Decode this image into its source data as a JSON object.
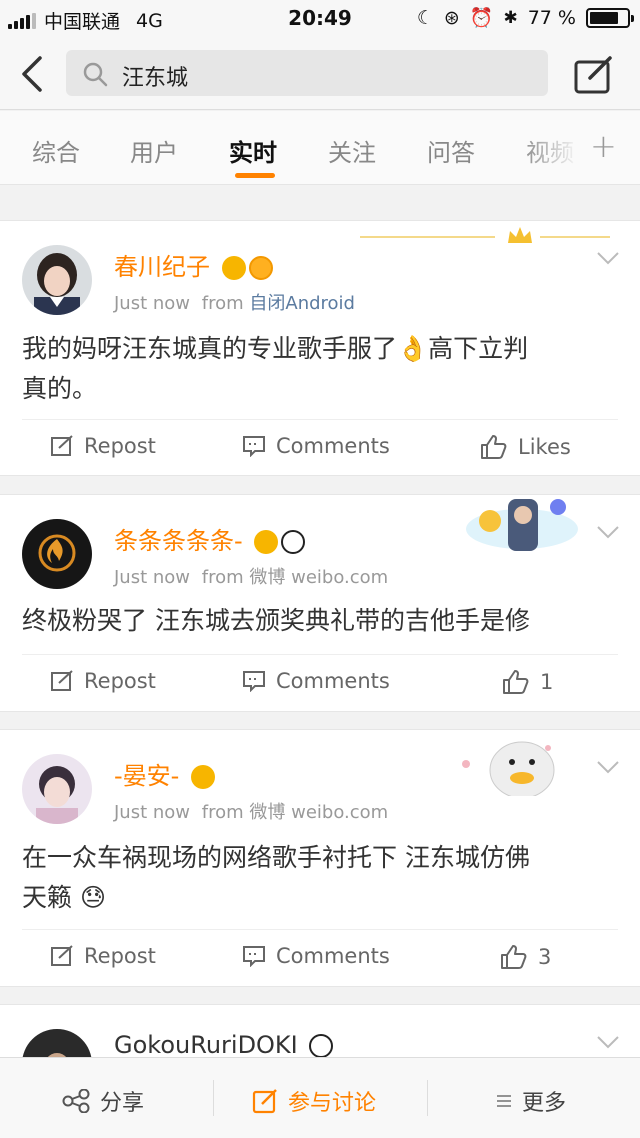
{
  "status_bar": {
    "carrier": "中国联通",
    "network": "4G",
    "time": "20:49",
    "battery": "77 %",
    "battery_level": 0.77
  },
  "search": {
    "query": "汪东城"
  },
  "tabs": [
    {
      "label": "综合"
    },
    {
      "label": "用户"
    },
    {
      "label": "实时",
      "active": true
    },
    {
      "label": "关注"
    },
    {
      "label": "问答"
    },
    {
      "label": "视频"
    }
  ],
  "colors": {
    "accent": "#ff8200",
    "source_link": "#5b7ba0"
  },
  "posts": [
    {
      "username": "春川纪子",
      "time": "Just now",
      "from_label": "from",
      "source": "自闭Android",
      "text_lines": [
        "我的妈呀汪东城真的专业歌手服了👌高下立判",
        "真的。"
      ],
      "repost_label": "Repost",
      "comments_label": "Comments",
      "likes_label": "Likes"
    },
    {
      "username": "条条条条条-",
      "time": "Just now",
      "from_label": "from",
      "source": "微博 weibo.com",
      "text_lines": [
        "终极粉哭了 汪东城去颁奖典礼带的吉他手是修"
      ],
      "repost_label": "Repost",
      "comments_label": "Comments",
      "likes_label": "1"
    },
    {
      "username": "-晏安-",
      "time": "Just now",
      "from_label": "from",
      "source": "微博 weibo.com",
      "text_lines": [
        "在一众车祸现场的网络歌手衬托下 汪东城仿佛",
        "天籁 😓"
      ],
      "repost_label": "Repost",
      "comments_label": "Comments",
      "likes_label": "3"
    },
    {
      "username": "GokouRuriDOKI"
    }
  ],
  "bottom_bar": {
    "share": "分享",
    "join": "参与讨论",
    "more": "更多"
  }
}
